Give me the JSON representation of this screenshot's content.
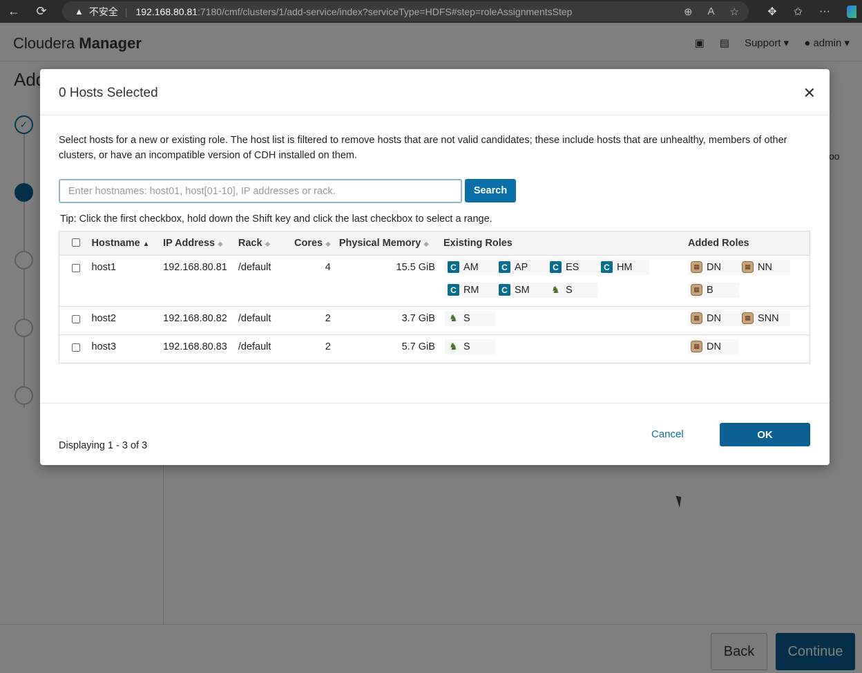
{
  "browser": {
    "insecure_label": "不安全",
    "url_host": "192.168.80.81",
    "url_path": ":7180/cmf/clusters/1/add-service/index?serviceType=HDFS#step=roleAssignmentsStep"
  },
  "app": {
    "brand_light": "Cloudera",
    "brand_bold": "Manager",
    "support_label": "Support",
    "user_label": "admin",
    "page_title": "Add",
    "side_snippet": "oo",
    "back_label": "Back",
    "continue_label": "Continue"
  },
  "modal": {
    "title": "0 Hosts Selected",
    "description": "Select hosts for a new or existing role. The host list is filtered to remove hosts that are not valid candidates; these include hosts that are unhealthy, members of other clusters, or have an incompatible version of CDH installed on them.",
    "search_placeholder": "Enter hostnames: host01, host[01-10], IP addresses or rack.",
    "search_button": "Search",
    "tip": "Tip: Click the first checkbox, hold down the Shift key and click the last checkbox to select a range.",
    "columns": {
      "hostname": "Hostname",
      "ip": "IP Address",
      "rack": "Rack",
      "cores": "Cores",
      "memory": "Physical Memory",
      "existing": "Existing Roles",
      "added": "Added Roles"
    },
    "rows": [
      {
        "hostname": "host1",
        "ip": "192.168.80.81",
        "rack": "/default",
        "cores": "4",
        "memory": "15.5 GiB",
        "existing": [
          "AM",
          "AP",
          "ES",
          "HM",
          "RM",
          "SM",
          "S"
        ],
        "added": [
          "DN",
          "NN",
          "B"
        ]
      },
      {
        "hostname": "host2",
        "ip": "192.168.80.82",
        "rack": "/default",
        "cores": "2",
        "memory": "3.7 GiB",
        "existing": [
          "S"
        ],
        "added": [
          "DN",
          "SNN"
        ]
      },
      {
        "hostname": "host3",
        "ip": "192.168.80.83",
        "rack": "/default",
        "cores": "2",
        "memory": "5.7 GiB",
        "existing": [
          "S"
        ],
        "added": [
          "DN"
        ]
      }
    ],
    "displaying": "Displaying 1 - 3 of 3",
    "cancel_label": "Cancel",
    "ok_label": "OK"
  }
}
